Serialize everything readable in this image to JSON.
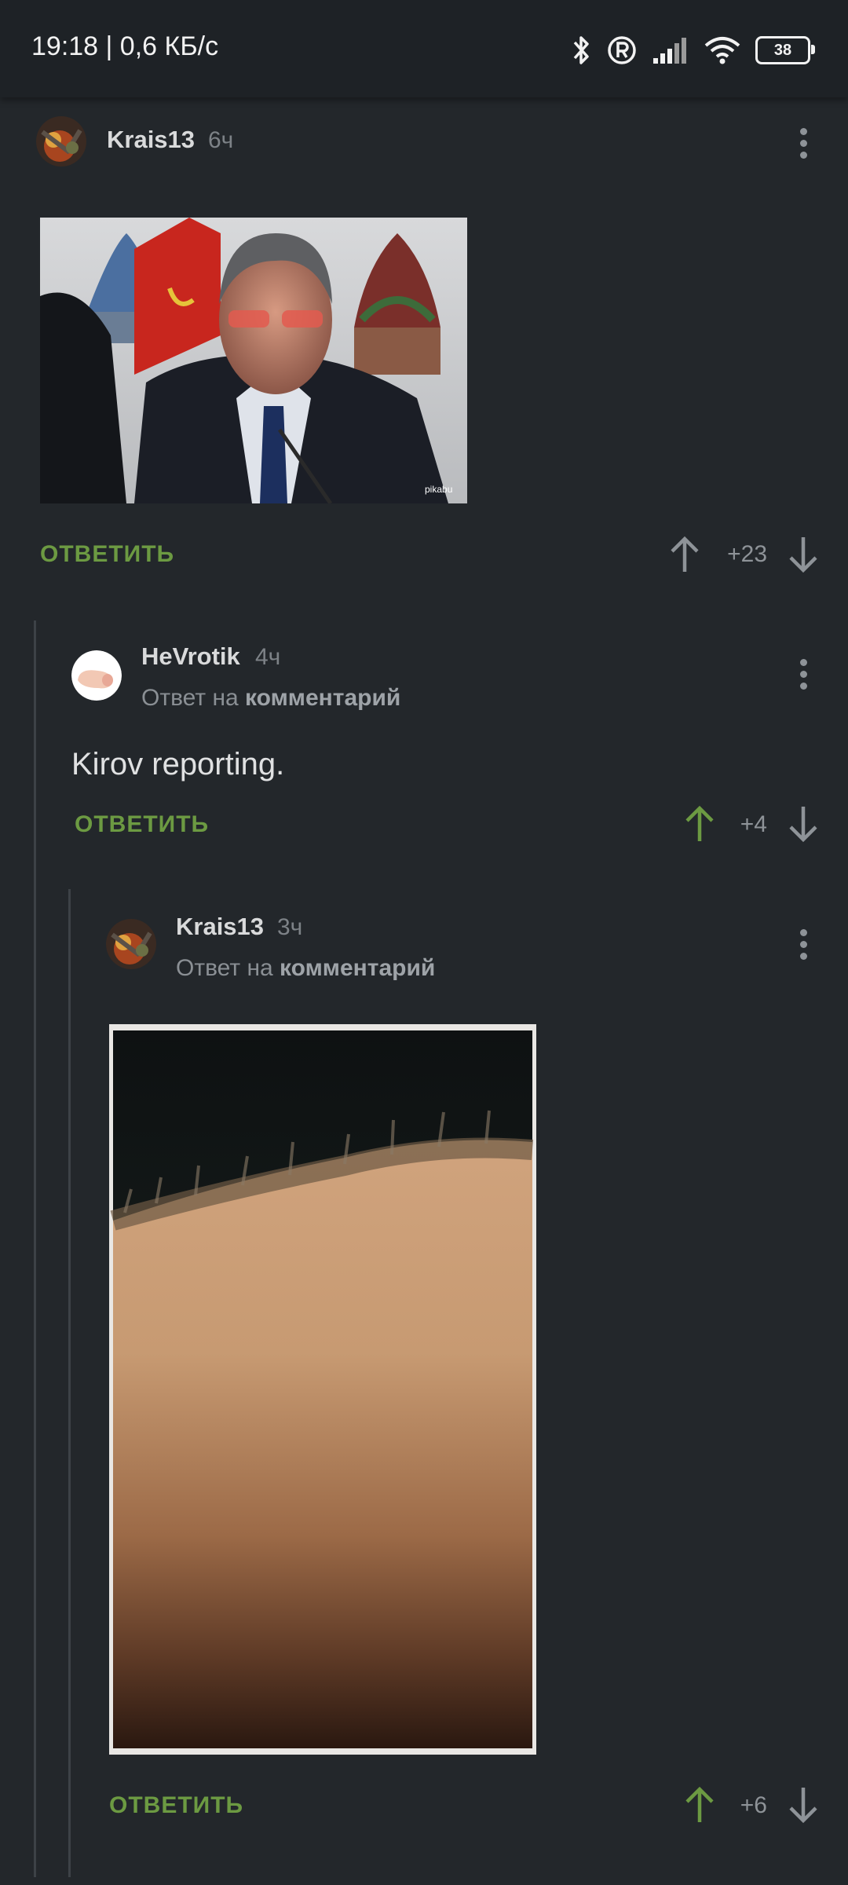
{
  "status": {
    "time": "19:18 | 0,6 КБ/с",
    "battery": "38",
    "icons": [
      "bluetooth-icon",
      "registered-icon",
      "signal-icon",
      "wifi-icon",
      "battery-icon"
    ]
  },
  "comments": [
    {
      "author": "Krais13",
      "time": "6ч",
      "reply_label": "ОТВЕТИТЬ",
      "score": "+23",
      "upvoted": false
    },
    {
      "author": "HeVrotik",
      "time": "4ч",
      "reply_to_prefix": "Ответ на ",
      "reply_to_link": "комментарий",
      "text": "Kirov reporting.",
      "reply_label": "ОТВЕТИТЬ",
      "score": "+4",
      "upvoted": true
    },
    {
      "author": "Krais13",
      "time": "3ч",
      "reply_to_prefix": "Ответ на ",
      "reply_to_link": "комментарий",
      "reply_label": "ОТВЕТИТЬ",
      "score": "+6",
      "upvoted": true
    }
  ],
  "colors": {
    "background": "#23272b",
    "accent_green": "#6c9a42",
    "muted": "#8e9398"
  }
}
